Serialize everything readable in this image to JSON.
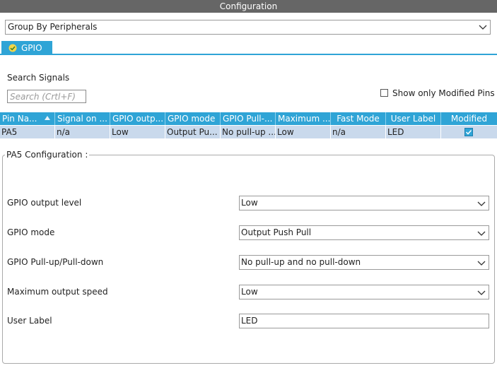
{
  "window": {
    "title": "Configuration"
  },
  "group_by": {
    "value": "Group By Peripherals"
  },
  "tabs": [
    {
      "label": "GPIO"
    }
  ],
  "search": {
    "label": "Search Signals",
    "placeholder": "Search (Crtl+F)"
  },
  "show_modified": {
    "label": "Show only Modified Pins",
    "checked": false
  },
  "table": {
    "columns": [
      "Pin Na...",
      "Signal on ...",
      "GPIO outp...",
      "GPIO mode",
      "GPIO Pull-...",
      "Maximum ...",
      "Fast Mode",
      "User Label",
      "Modified"
    ],
    "rows": [
      {
        "pin": "PA5",
        "signal": "n/a",
        "output": "Low",
        "mode": "Output Pu...",
        "pull": "No pull-up ...",
        "speed": "Low",
        "fast": "n/a",
        "label": "LED",
        "modified": true
      }
    ]
  },
  "config": {
    "title": "PA5 Configuration :",
    "fields": [
      {
        "label": "GPIO output level",
        "value": "Low"
      },
      {
        "label": "GPIO mode",
        "value": "Output Push Pull"
      },
      {
        "label": "GPIO Pull-up/Pull-down",
        "value": "No pull-up and no pull-down"
      },
      {
        "label": "Maximum output speed",
        "value": "Low"
      },
      {
        "label": "User Label",
        "value": "LED"
      }
    ]
  },
  "colors": {
    "accent": "#2fa4d6",
    "titlebar": "#666666",
    "selected_row": "#c9d9ec"
  },
  "icons": {
    "dropdown": "chevron-down-icon",
    "tab": "check-circle-icon",
    "sort": "sort-arrow-icon",
    "modified": "checkbox-checked-icon"
  }
}
